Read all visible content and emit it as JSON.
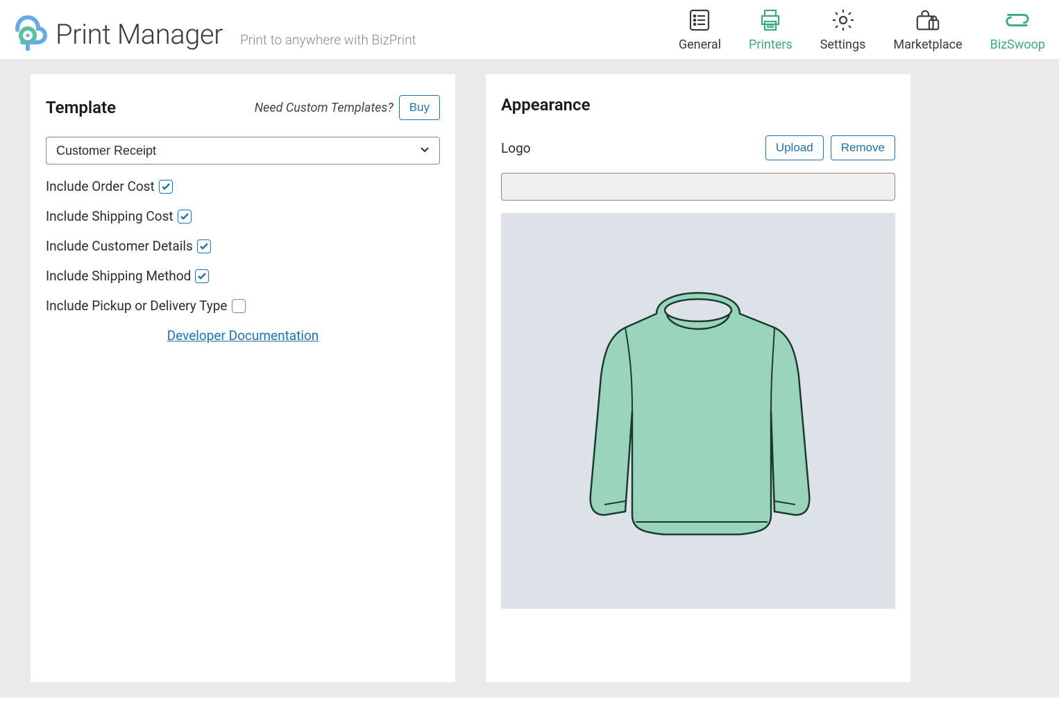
{
  "header": {
    "app_title": "Print Manager",
    "tagline": "Print to anywhere with BizPrint"
  },
  "nav": {
    "items": [
      {
        "label": "General",
        "icon": "list-icon"
      },
      {
        "label": "Printers",
        "icon": "printer-icon"
      },
      {
        "label": "Settings",
        "icon": "gear-icon"
      },
      {
        "label": "Marketplace",
        "icon": "shopping-bag-icon"
      },
      {
        "label": "BizSwoop",
        "icon": "bizswoop-icon"
      }
    ],
    "active_index": 1
  },
  "template": {
    "title": "Template",
    "custom_prompt": "Need Custom Templates?",
    "buy_label": "Buy",
    "selected": "Customer Receipt",
    "options": [
      {
        "label": "Include Order Cost",
        "checked": true
      },
      {
        "label": "Include Shipping Cost",
        "checked": true
      },
      {
        "label": "Include Customer Details",
        "checked": true
      },
      {
        "label": "Include Shipping Method",
        "checked": true
      },
      {
        "label": "Include Pickup or Delivery Type",
        "checked": false
      }
    ],
    "dev_docs_label": "Developer Documentation"
  },
  "appearance": {
    "title": "Appearance",
    "logo_label": "Logo",
    "upload_label": "Upload",
    "remove_label": "Remove"
  },
  "colors": {
    "accent_green": "#3ea87f",
    "accent_blue": "#2271b1",
    "logo_teal": "#5bbfa0",
    "logo_blue": "#6aa9e8"
  }
}
